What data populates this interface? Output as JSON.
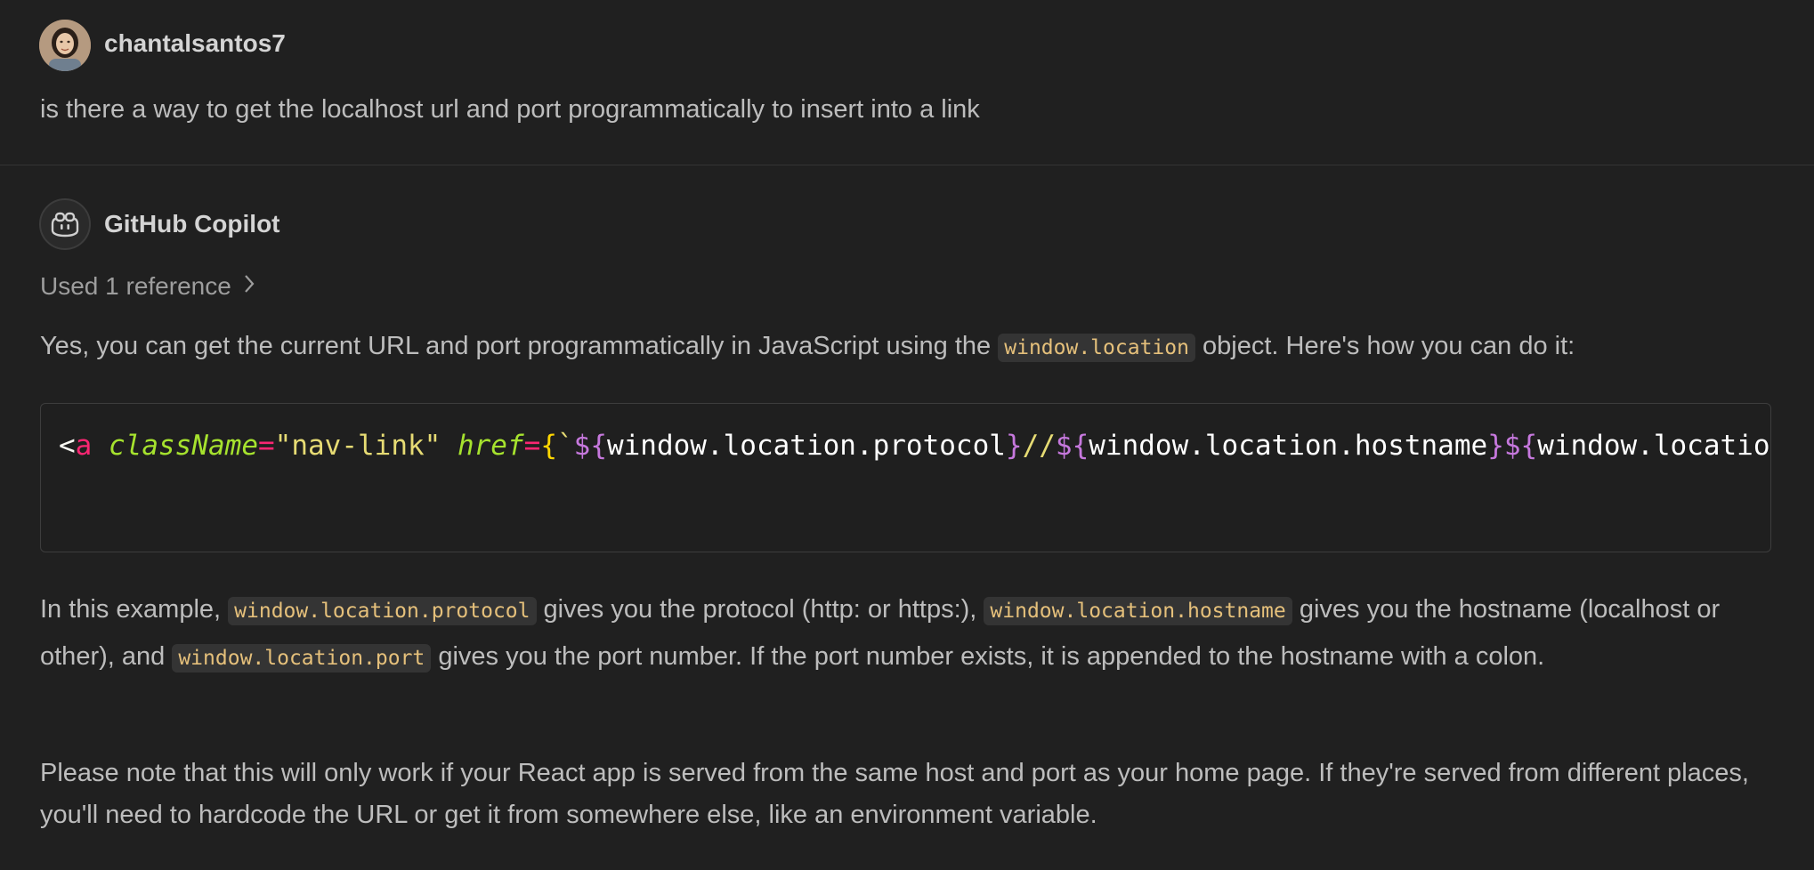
{
  "request": {
    "username": "chantalsantos7",
    "text": "is there a way to get the localhost url and port programmatically to insert into a link"
  },
  "response": {
    "author": "GitHub Copilot",
    "references_label": "Used 1 reference",
    "intro_before": "Yes, you can get the current URL and port programmatically in JavaScript using the ",
    "intro_code": "window.location",
    "intro_after": " object. Here's how you can do it:",
    "code_tokens": [
      {
        "t": "<",
        "c": "t-punct"
      },
      {
        "t": "a",
        "c": "t-tag"
      },
      {
        "t": " ",
        "c": "t-plain"
      },
      {
        "t": "className",
        "c": "t-attr"
      },
      {
        "t": "=",
        "c": "t-eq"
      },
      {
        "t": "\"nav-link\"",
        "c": "t-str"
      },
      {
        "t": " ",
        "c": "t-plain"
      },
      {
        "t": "href",
        "c": "t-attr"
      },
      {
        "t": "=",
        "c": "t-eq"
      },
      {
        "t": "{",
        "c": "t-brace"
      },
      {
        "t": "`",
        "c": "t-tmpl"
      },
      {
        "t": "${",
        "c": "t-interp"
      },
      {
        "t": "window.location.protocol",
        "c": "t-plain"
      },
      {
        "t": "}",
        "c": "t-interp"
      },
      {
        "t": "//",
        "c": "t-tmpl"
      },
      {
        "t": "${",
        "c": "t-interp"
      },
      {
        "t": "window.location.hostname",
        "c": "t-plain"
      },
      {
        "t": "}",
        "c": "t-interp"
      },
      {
        "t": "${",
        "c": "t-interp"
      },
      {
        "t": "window.location",
        "c": "t-plain"
      }
    ],
    "p2_a": "In this example, ",
    "p2_code1": "window.location.protocol",
    "p2_b": " gives you the protocol (http: or https:), ",
    "p2_code2": "window.location.hostname",
    "p2_c": " gives you the hostname (localhost or other), and ",
    "p2_code3": "window.location.port",
    "p2_d": " gives you the port number. If the port number exists, it is appended to the hostname with a colon.",
    "p3": "Please note that this will only work if your React app is served from the same host and port as your home page. If they're served from different places, you'll need to hardcode the URL or get it from somewhere else, like an environment variable."
  },
  "icons": {
    "user_avatar": "user-avatar-photo",
    "copilot_avatar": "copilot-icon",
    "chevron": "chevron-right-icon"
  },
  "colors": {
    "background": "#202020",
    "inline_code_text": "#e5c07b",
    "inline_code_bg": "#343434"
  }
}
